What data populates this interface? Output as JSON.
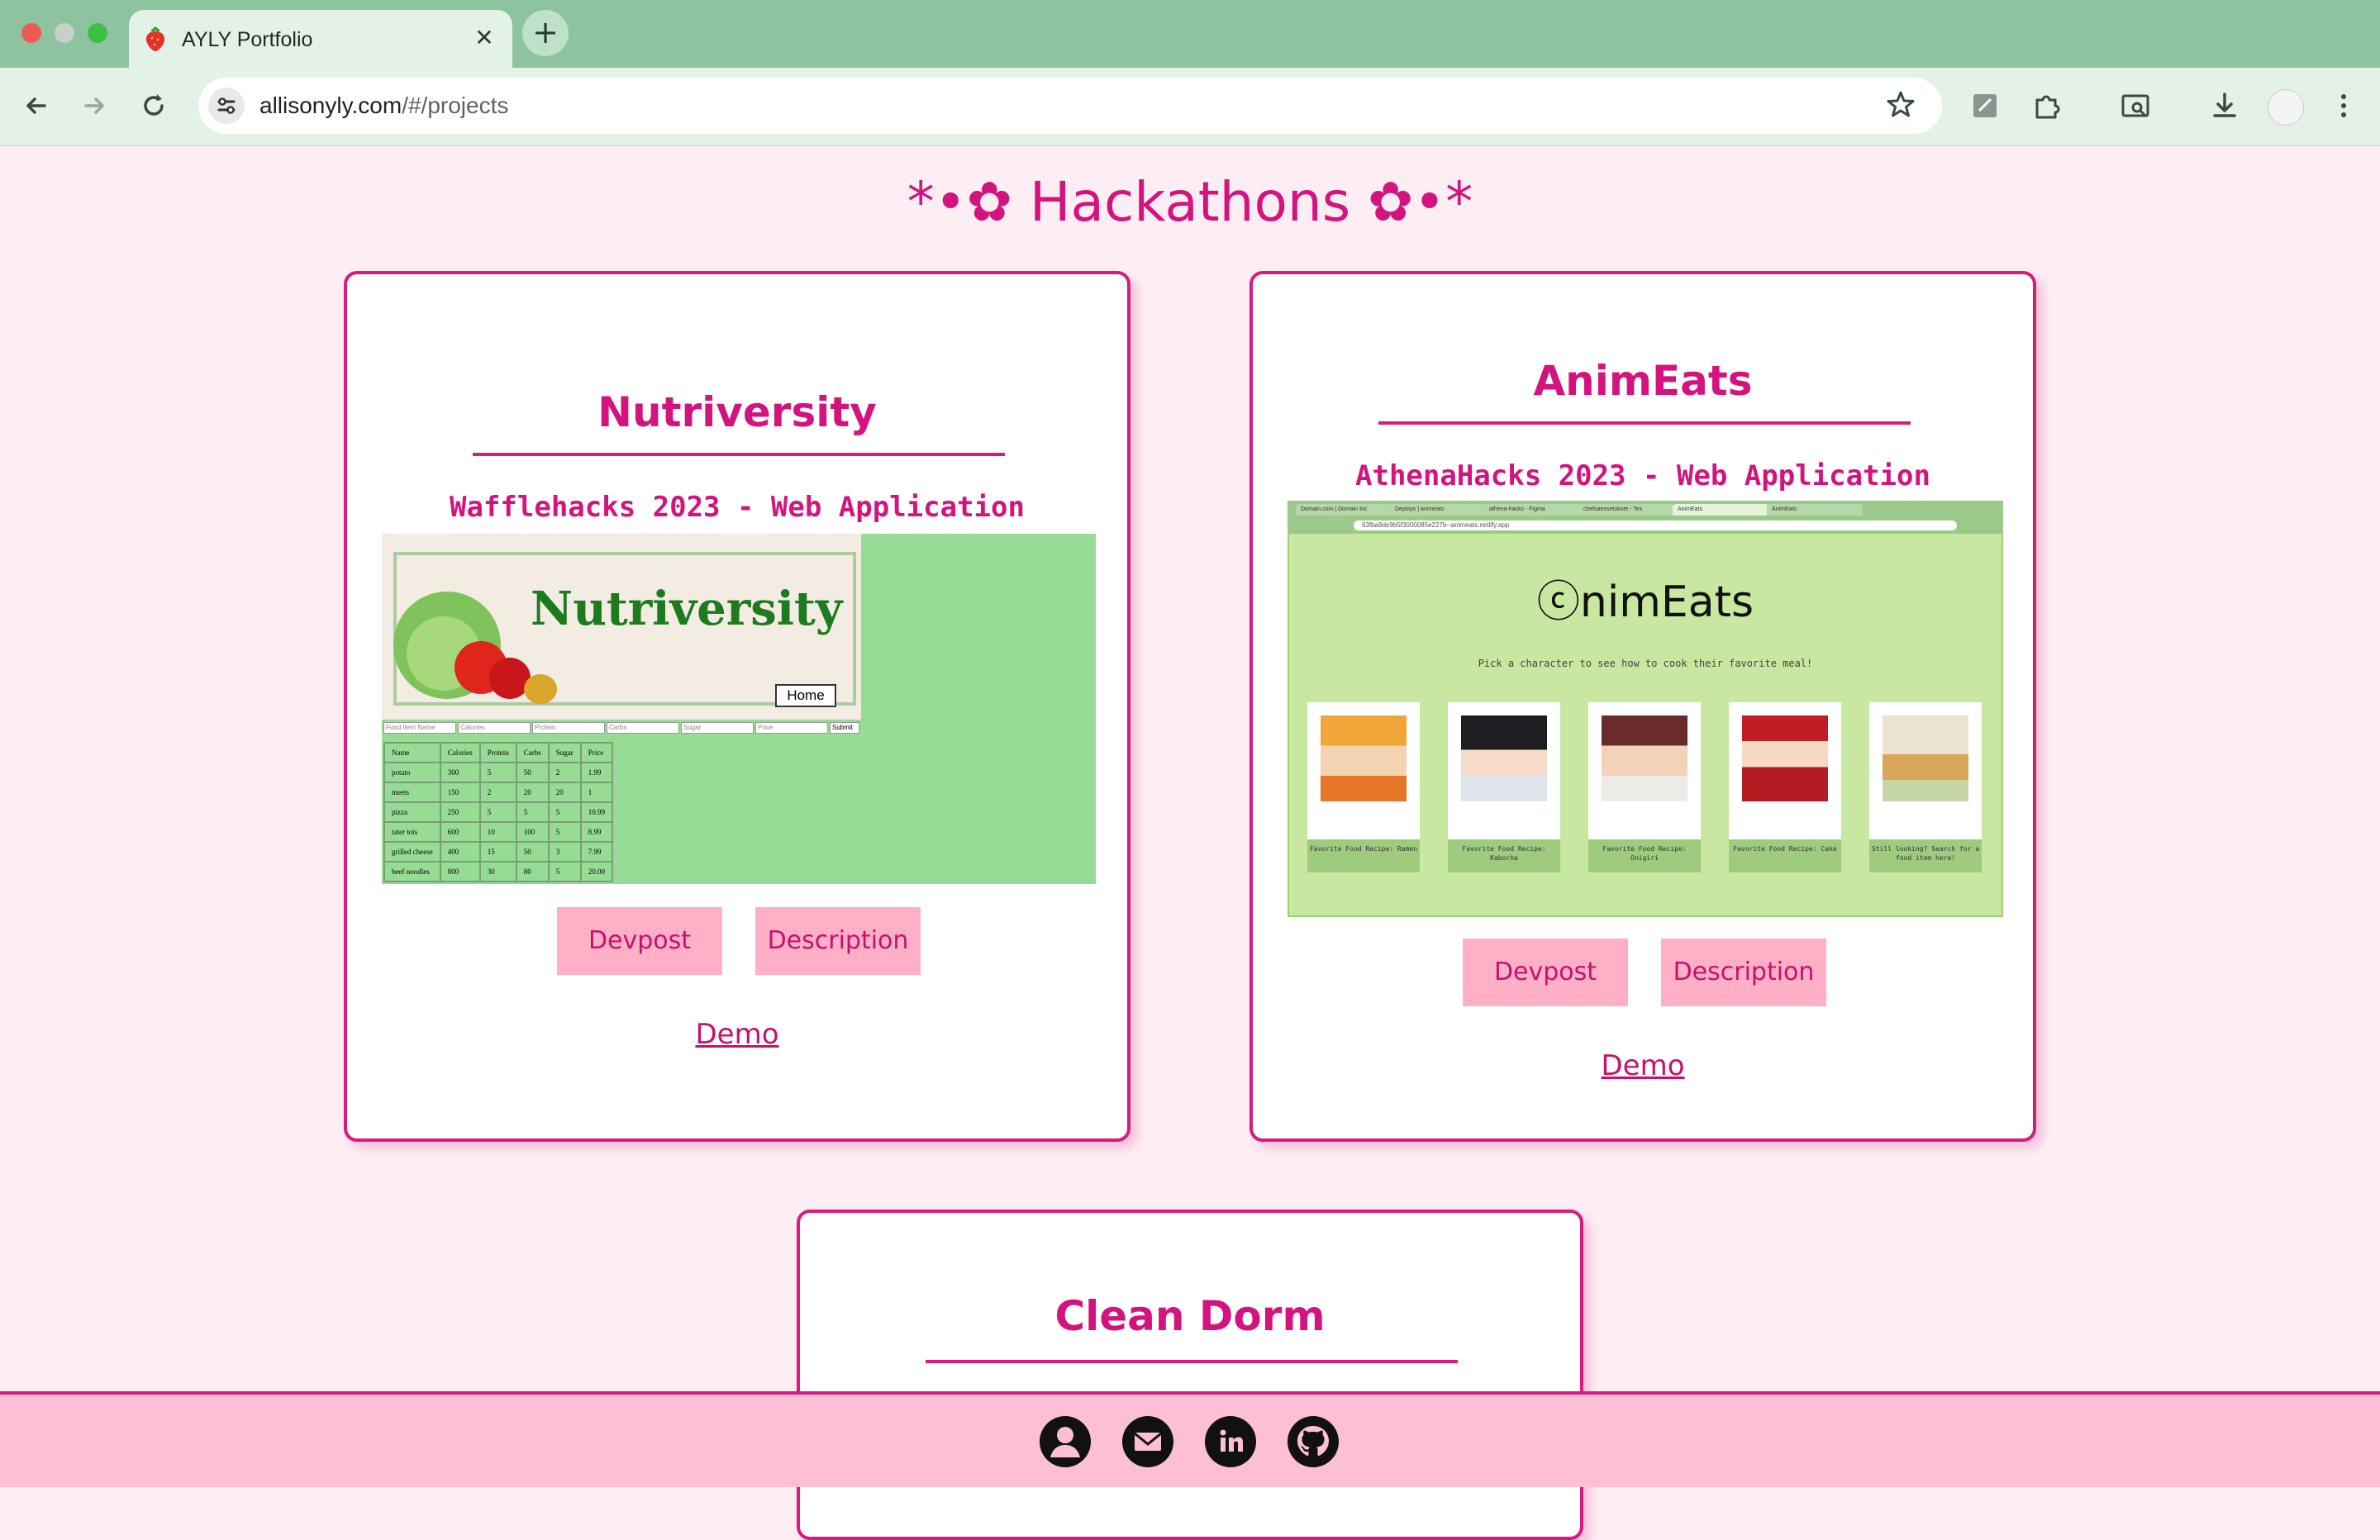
{
  "browser": {
    "tab_title": "AYLY Portfolio",
    "tab_close": "✕",
    "new_tab": "+",
    "url_host": "allisonyly.com",
    "url_path": "/#/projects"
  },
  "page": {
    "heading": "*•✿ Hackathons ✿•*"
  },
  "projects": [
    {
      "title": "Nutriversity",
      "subtitle": "Wafflehacks 2023 - Web Application",
      "devpost_label": "Devpost",
      "description_label": "Description",
      "demo_label": "Demo",
      "preview": {
        "banner_text": "Nutriversity",
        "home_label": "Home",
        "input_placeholders": [
          "Food Item Name",
          "Calories",
          "Protein",
          "Carbs",
          "Sugar",
          "Price"
        ],
        "submit_label": "Submit",
        "table_headers": [
          "Name",
          "Calories",
          "Protein",
          "Carbs",
          "Sugar",
          "Price"
        ],
        "table_rows": [
          [
            "potato",
            "300",
            "5",
            "50",
            "2",
            "1.99"
          ],
          [
            "meets",
            "150",
            "2",
            "20",
            "20",
            "1"
          ],
          [
            "pizza",
            "250",
            "5",
            "5",
            "5",
            "10.99"
          ],
          [
            "tater tots",
            "600",
            "10",
            "100",
            "5",
            "8.99"
          ],
          [
            "grilled cheese",
            "400",
            "15",
            "50",
            "3",
            "7.99"
          ],
          [
            "beef noodles",
            "800",
            "30",
            "80",
            "5",
            "20.00"
          ]
        ]
      }
    },
    {
      "title": "AnimEats",
      "subtitle": "AthenaHacks 2023 - Web Application",
      "devpost_label": "Devpost",
      "description_label": "Description",
      "demo_label": "Demo",
      "preview": {
        "logo_text": "ⓒnimEats",
        "tagline": "Pick a character to see how to cook their favorite meal!",
        "url": "63fba9de9b5f3000085e227b--animeats.netlify.app",
        "tabs": [
          "Domain.com | Domain Inc",
          "Deploys | animeats",
          "athena-hacks - Figma",
          "chefsaessetukset - Tex",
          "AnimEats",
          "AnimEats"
        ],
        "cards": [
          {
            "caption": "Favorite Food Recipe: Ramen"
          },
          {
            "caption": "Favorite Food Recipe: Kabocha"
          },
          {
            "caption": "Favorite Food Recipe: Onigiri"
          },
          {
            "caption": "Favorite Food Recipe: Cake"
          },
          {
            "caption": "Still looking? Search for a food item here!"
          }
        ]
      }
    },
    {
      "title": "Clean Dorm"
    }
  ],
  "footer": {
    "icons": [
      "profile-icon",
      "mail-icon",
      "linkedin-icon",
      "github-icon"
    ]
  },
  "colors": {
    "accent": "#d81b7f",
    "button_bg": "#ffafc6",
    "page_bg": "#fdeef4",
    "chrome_bg": "#8dc39e"
  }
}
